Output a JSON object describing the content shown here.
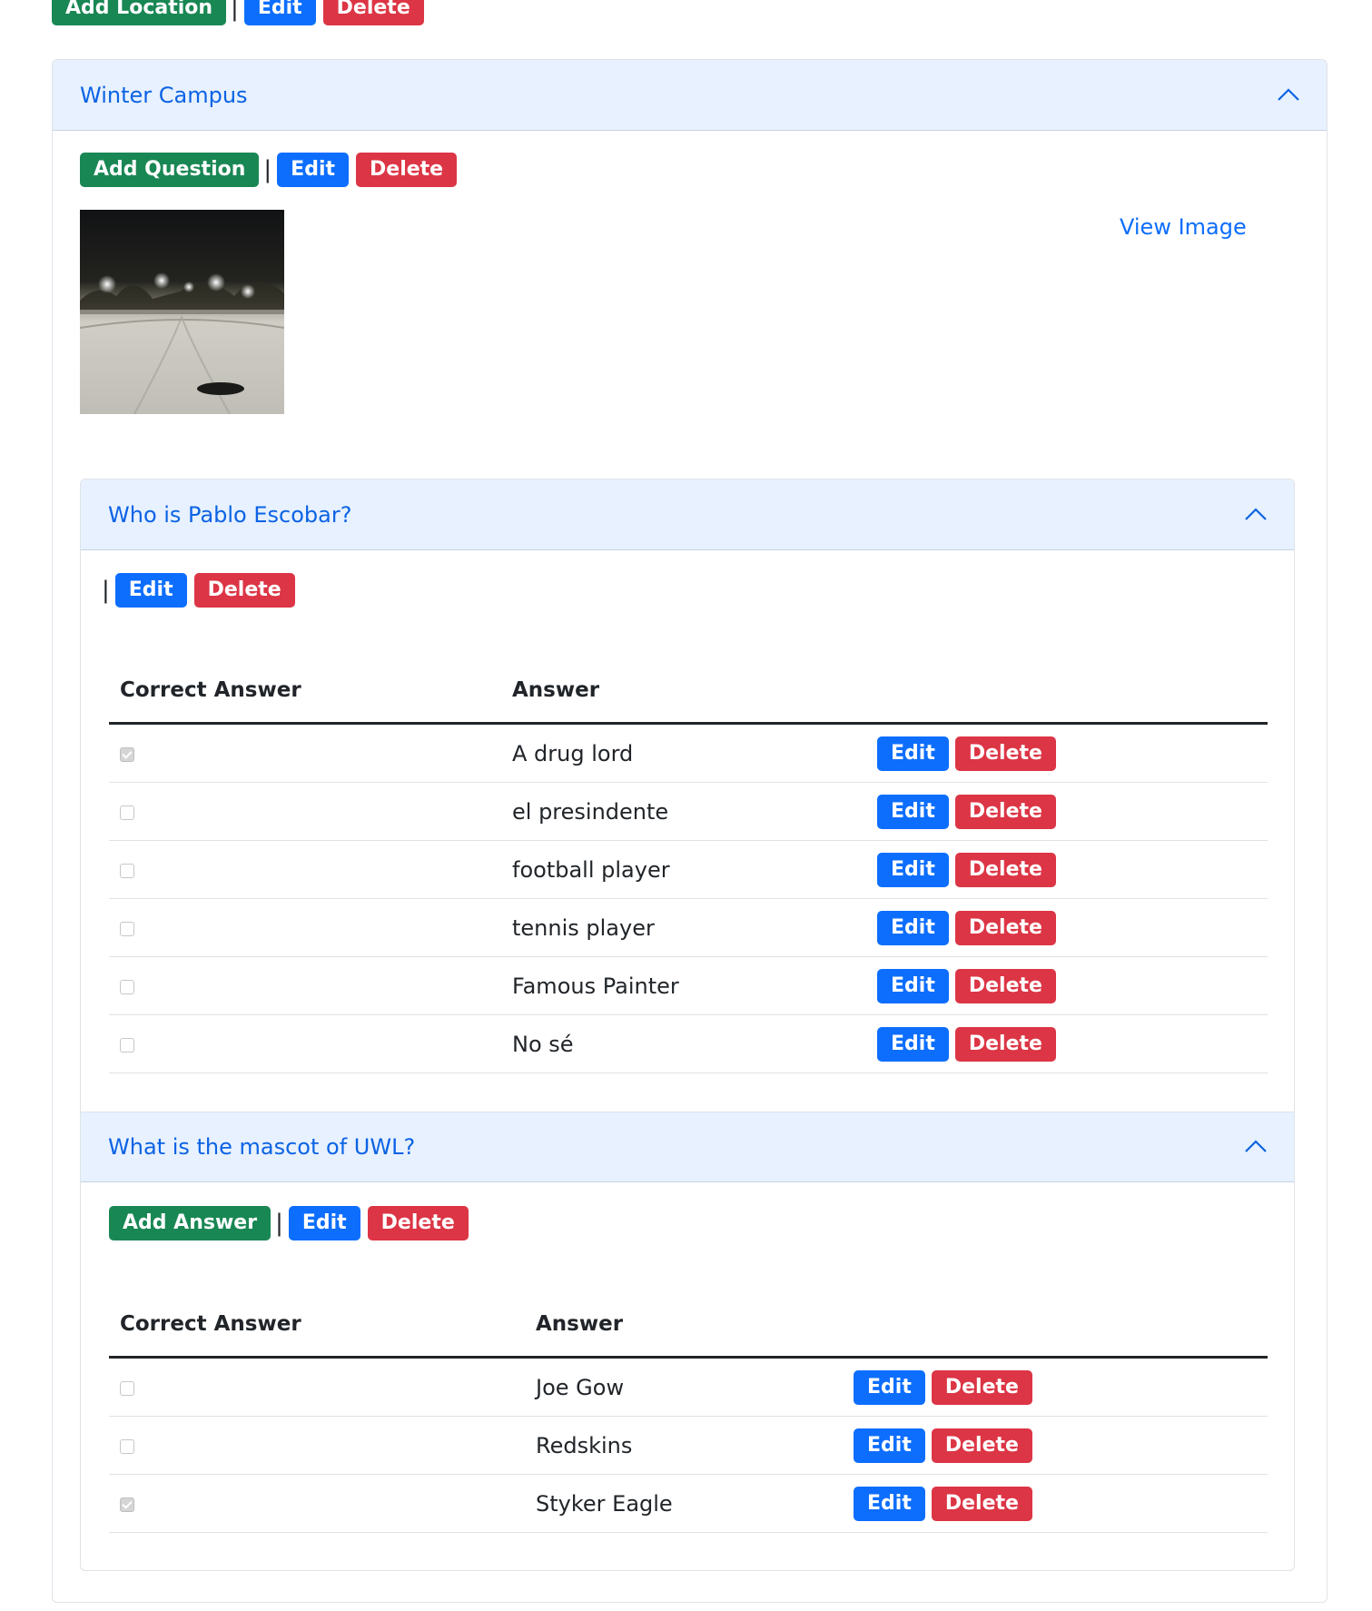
{
  "top_toolbar": {
    "add_label": "Add Location",
    "separator": "|",
    "edit_label": "Edit",
    "delete_label": "Delete"
  },
  "location": {
    "title": "Winter Campus",
    "toolbar": {
      "add_label": "Add Question",
      "separator": "|",
      "edit_label": "Edit",
      "delete_label": "Delete"
    },
    "view_image_label": "View Image",
    "questions": [
      {
        "title": "Who is Pablo Escobar?",
        "toolbar": {
          "separator": "|",
          "edit_label": "Edit",
          "delete_label": "Delete"
        },
        "columns": [
          "Correct Answer",
          "Answer"
        ],
        "rows": [
          {
            "correct": true,
            "answer": "A drug lord",
            "edit_label": "Edit",
            "delete_label": "Delete"
          },
          {
            "correct": false,
            "answer": "el presindente",
            "edit_label": "Edit",
            "delete_label": "Delete"
          },
          {
            "correct": false,
            "answer": "football player",
            "edit_label": "Edit",
            "delete_label": "Delete"
          },
          {
            "correct": false,
            "answer": "tennis player",
            "edit_label": "Edit",
            "delete_label": "Delete"
          },
          {
            "correct": false,
            "answer": "Famous Painter",
            "edit_label": "Edit",
            "delete_label": "Delete"
          },
          {
            "correct": false,
            "answer": "No sé",
            "edit_label": "Edit",
            "delete_label": "Delete"
          }
        ]
      },
      {
        "title": "What is the mascot of UWL?",
        "toolbar": {
          "add_label": "Add Answer",
          "separator": "|",
          "edit_label": "Edit",
          "delete_label": "Delete"
        },
        "columns": [
          "Correct Answer",
          "Answer"
        ],
        "rows": [
          {
            "correct": false,
            "answer": "Joe Gow",
            "edit_label": "Edit",
            "delete_label": "Delete"
          },
          {
            "correct": false,
            "answer": "Redskins",
            "edit_label": "Edit",
            "delete_label": "Delete"
          },
          {
            "correct": true,
            "answer": "Styker Eagle",
            "edit_label": "Edit",
            "delete_label": "Delete"
          }
        ]
      }
    ]
  },
  "colors": {
    "success": "#198754",
    "primary": "#0d6efd",
    "danger": "#dc3545",
    "accordion_header": "#e7f1ff",
    "accordion_text": "#0c63e4"
  },
  "icons": {
    "collapse": "chevron-up-icon",
    "checkbox": "checkbox-icon"
  }
}
